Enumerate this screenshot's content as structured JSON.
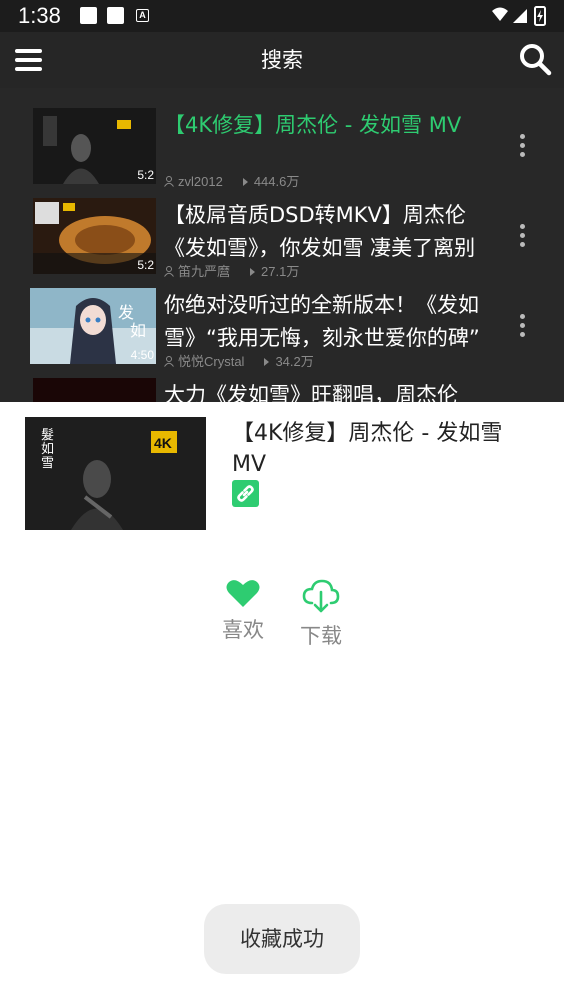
{
  "status_bar": {
    "time": "1:38",
    "a_icon": "A"
  },
  "app_bar": {
    "title": "搜索"
  },
  "list": [
    {
      "title": "【4K修复】周杰伦 - 发如雪 MV",
      "duration": "5:2",
      "author": "zvl2012",
      "views": "444.6万",
      "active": true
    },
    {
      "title": "【极屌音质DSD转MKV】周杰伦《发如雪》，你发如雪 凄美了离别",
      "duration": "5:2",
      "author": "笛九严麿",
      "views": "27.1万",
      "active": false
    },
    {
      "title": "你绝对没听过的全新版本！《发如雪》“我用无悔，刻永世爱你的碑”",
      "duration": "4:50",
      "author": "悦悦Crystal",
      "views": "34.2万",
      "active": false
    },
    {
      "title": "大力《发如雪》旺翻唱，周杰伦",
      "duration": "",
      "author": "",
      "views": "",
      "active": false
    }
  ],
  "sheet": {
    "title": "【4K修复】周杰伦 - 发如雪 MV",
    "like_label": "喜欢",
    "download_label": "下载"
  },
  "toast": {
    "text": "收藏成功"
  },
  "colors": {
    "accent": "#2ecc71",
    "dark_bg": "#282828",
    "bar_bg": "#262626"
  }
}
